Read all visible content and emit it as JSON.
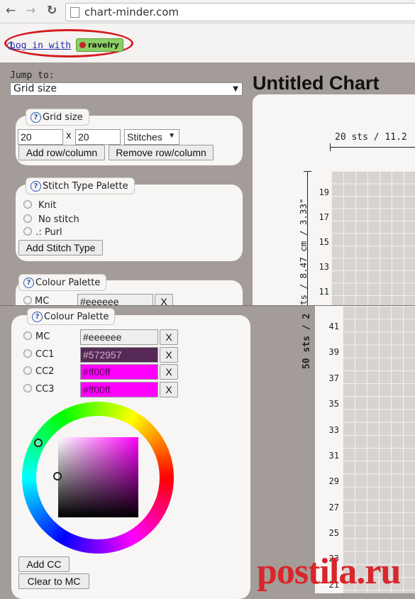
{
  "browser": {
    "url": "chart-minder.com",
    "icons": [
      "back-arrow-icon",
      "forward-arrow-icon",
      "reload-icon",
      "page-icon"
    ]
  },
  "login": {
    "link_text": "Log in with",
    "badge": "ravelry"
  },
  "jump": {
    "label": "Jump to:",
    "selected": "Grid size"
  },
  "grid_size": {
    "title": "Grid size",
    "width": "20",
    "times": "x",
    "height": "20",
    "unit": "Stitches",
    "add_label": "Add row/column",
    "remove_label": "Remove row/column"
  },
  "stitch_palette": {
    "title": "Stitch Type Palette",
    "items": [
      "Knit",
      "No stitch",
      "․: Purl"
    ],
    "add_label": "Add Stitch Type"
  },
  "colour_palette": {
    "title": "Colour Palette",
    "colours": [
      {
        "name": "MC",
        "value": "#eeeeee",
        "bg": "#eeeeee",
        "fg": "#222222"
      },
      {
        "name": "CC1",
        "value": "#572957",
        "bg": "#572957",
        "fg": "#c8b2c8"
      },
      {
        "name": "CC2",
        "value": "#ff00ff",
        "bg": "#ff00ff",
        "fg": "#5a005a"
      },
      {
        "name": "CC3",
        "value": "#ff00ff",
        "bg": "#ff00ff",
        "fg": "#5a005a"
      }
    ],
    "remove_label": "X",
    "add_label": "Add CC",
    "clear_label": "Clear to MC"
  },
  "chart": {
    "title": "Untitled Chart",
    "top_measure": "20 sts / 11.2",
    "side_measure_1": "ts / 8.47 cm / 3.33\"",
    "side_measure_2": "50 sts / 2",
    "rows_top": [
      "19",
      "17",
      "15",
      "13",
      "11"
    ],
    "rows_bottom": [
      "41",
      "39",
      "37",
      "35",
      "33",
      "31",
      "29",
      "27",
      "25",
      "23",
      "21"
    ]
  },
  "watermark": "postila.ru"
}
